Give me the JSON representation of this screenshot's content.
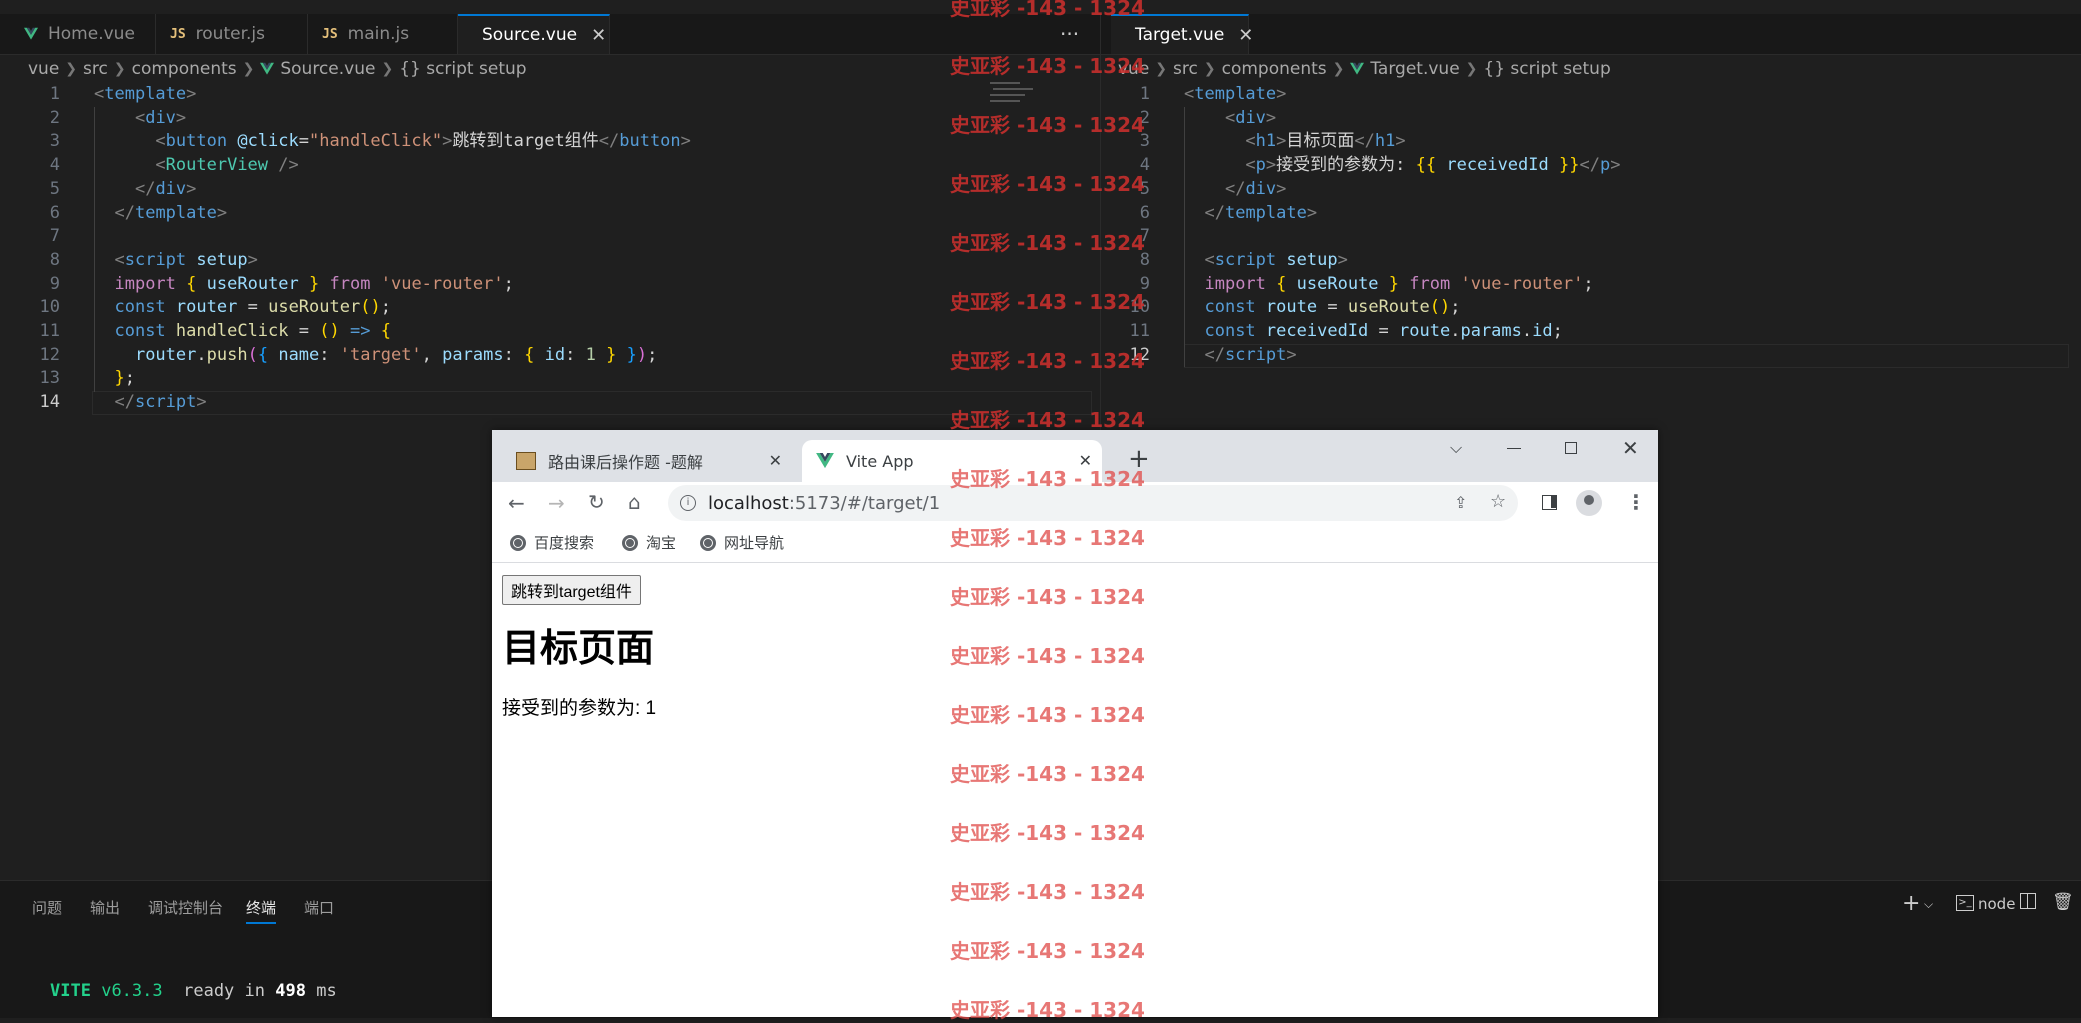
{
  "left_editor": {
    "tabs": [
      {
        "label": "Home.vue",
        "icon": "vue-icon"
      },
      {
        "label": "router.js",
        "icon": "js-icon"
      },
      {
        "label": "main.js",
        "icon": "js-icon"
      },
      {
        "label": "Source.vue",
        "icon": "vue-icon",
        "active": true
      }
    ],
    "js_icon_text": "JS",
    "more_label": "···",
    "breadcrumb": [
      "vue",
      "src",
      "components",
      "Source.vue",
      "{} script setup"
    ],
    "line_numbers": [
      "1",
      "2",
      "3",
      "4",
      "5",
      "6",
      "7",
      "8",
      "9",
      "10",
      "11",
      "12",
      "13",
      "14"
    ]
  },
  "right_editor": {
    "tab": {
      "label": "Target.vue",
      "icon": "vue-icon"
    },
    "breadcrumb": [
      "vue",
      "src",
      "components",
      "Target.vue",
      "{} script setup"
    ],
    "line_numbers": [
      "1",
      "2",
      "3",
      "4",
      "5",
      "6",
      "7",
      "8",
      "9",
      "10",
      "11",
      "12"
    ]
  },
  "panel": {
    "tabs": [
      "问题",
      "输出",
      "调试控制台",
      "终端",
      "端口"
    ],
    "active_tab": "终端",
    "terminal_name": "node",
    "terminal": {
      "vite": "VITE",
      "version": "v6.3.3",
      "ready": "ready in",
      "ms_value": "498",
      "ms": "ms"
    }
  },
  "browser": {
    "tabs": [
      {
        "label": "路由课后操作题 -题解",
        "icon": "page-favicon"
      },
      {
        "label": "Vite App",
        "icon": "vue-icon",
        "active": true
      }
    ],
    "url_host": "localhost",
    "url_rest": ":5173/#/target/1",
    "bookmarks": [
      "百度搜索",
      "淘宝",
      "网址导航"
    ],
    "page": {
      "button_label": "跳转到target组件",
      "heading": "目标页面",
      "paragraph": "接受到的参数为: 1"
    }
  },
  "watermark": "史亚彩 -143 - 1324",
  "colors": {
    "accent": "#0078d4",
    "watermark": "#d0302e",
    "vue_green": "#41b883"
  }
}
